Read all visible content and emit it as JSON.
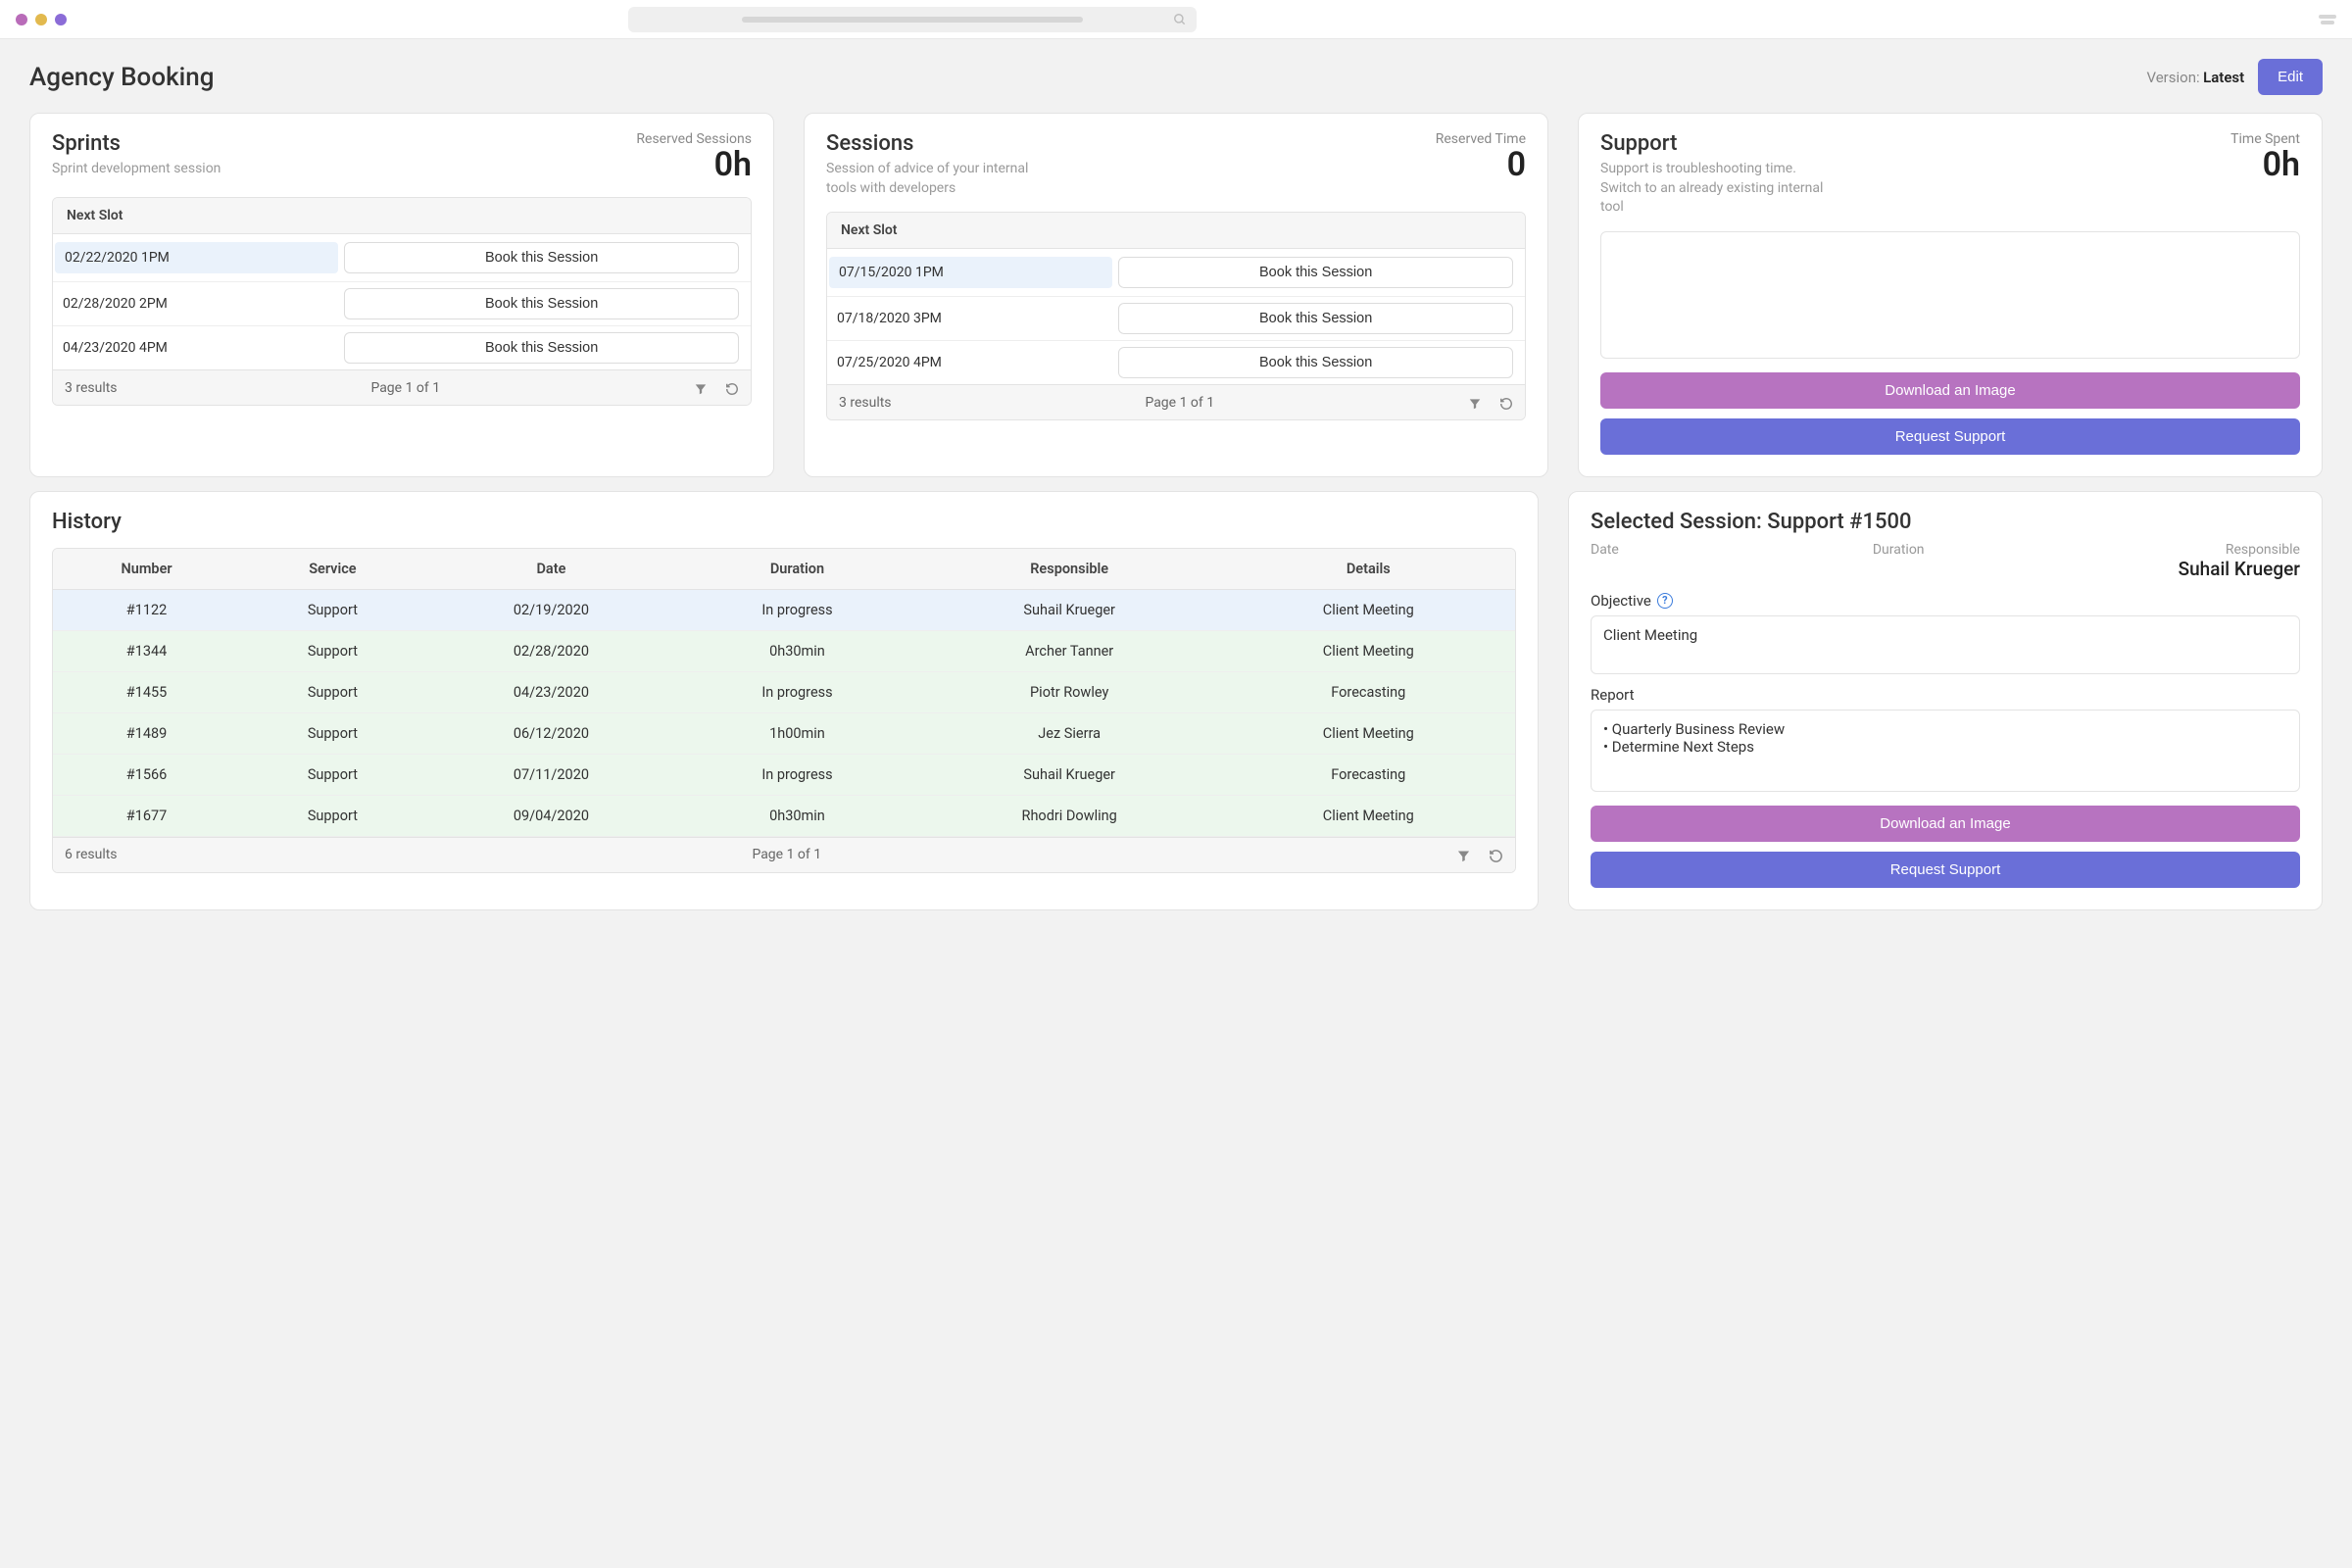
{
  "header": {
    "title": "Agency Booking",
    "version_label": "Version:",
    "version_value": "Latest",
    "edit_button": "Edit"
  },
  "sprints": {
    "title": "Sprints",
    "subtitle": "Sprint development session",
    "stat_label": "Reserved Sessions",
    "stat_value": "0h",
    "next_slot_label": "Next Slot",
    "slots": [
      {
        "date": "02/22/2020 1PM",
        "button": "Book this Session",
        "highlight": true
      },
      {
        "date": "02/28/2020 2PM",
        "button": "Book this Session",
        "highlight": false
      },
      {
        "date": "04/23/2020 4PM",
        "button": "Book this Session",
        "highlight": false
      }
    ],
    "results_text": "3 results",
    "page_text": "Page 1 of 1"
  },
  "sessions": {
    "title": "Sessions",
    "subtitle": "Session of advice of your internal tools with developers",
    "stat_label": "Reserved Time",
    "stat_value": "0",
    "next_slot_label": "Next Slot",
    "slots": [
      {
        "date": "07/15/2020 1PM",
        "button": "Book this Session",
        "highlight": true
      },
      {
        "date": "07/18/2020 3PM",
        "button": "Book this Session",
        "highlight": false
      },
      {
        "date": "07/25/2020 4PM",
        "button": "Book this Session",
        "highlight": false
      }
    ],
    "results_text": "3 results",
    "page_text": "Page 1 of 1"
  },
  "support": {
    "title": "Support",
    "subtitle": "Support is troubleshooting time. Switch to an already existing internal tool",
    "stat_label": "Time Spent",
    "stat_value": "0h",
    "download_button": "Download an Image",
    "request_button": "Request Support"
  },
  "history": {
    "title": "History",
    "columns": [
      "Number",
      "Service",
      "Date",
      "Duration",
      "Responsible",
      "Details"
    ],
    "rows": [
      {
        "number": "#1122",
        "service": "Support",
        "date": "02/19/2020",
        "duration": "In progress",
        "responsible": "Suhail Krueger",
        "details": "Client Meeting",
        "tone": "blue"
      },
      {
        "number": "#1344",
        "service": "Support",
        "date": "02/28/2020",
        "duration": "0h30min",
        "responsible": "Archer Tanner",
        "details": "Client Meeting",
        "tone": "green"
      },
      {
        "number": "#1455",
        "service": "Support",
        "date": "04/23/2020",
        "duration": "In progress",
        "responsible": "Piotr Rowley",
        "details": "Forecasting",
        "tone": "green"
      },
      {
        "number": "#1489",
        "service": "Support",
        "date": "06/12/2020",
        "duration": "1h00min",
        "responsible": "Jez Sierra",
        "details": "Client Meeting",
        "tone": "green"
      },
      {
        "number": "#1566",
        "service": "Support",
        "date": "07/11/2020",
        "duration": "In progress",
        "responsible": "Suhail Krueger",
        "details": "Forecasting",
        "tone": "green"
      },
      {
        "number": "#1677",
        "service": "Support",
        "date": "09/04/2020",
        "duration": "0h30min",
        "responsible": "Rhodri Dowling",
        "details": "Client Meeting",
        "tone": "green"
      }
    ],
    "results_text": "6 results",
    "page_text": "Page 1 of 1"
  },
  "selected": {
    "title": "Selected Session: Support #1500",
    "date_label": "Date",
    "date_value": "",
    "duration_label": "Duration",
    "duration_value": "",
    "responsible_label": "Responsible",
    "responsible_value": "Suhail Krueger",
    "objective_label": "Objective",
    "objective_value": "Client Meeting",
    "report_label": "Report",
    "report_items": [
      "Quarterly Business Review",
      "Determine Next Steps"
    ],
    "download_button": "Download an Image",
    "request_button": "Request Support"
  }
}
